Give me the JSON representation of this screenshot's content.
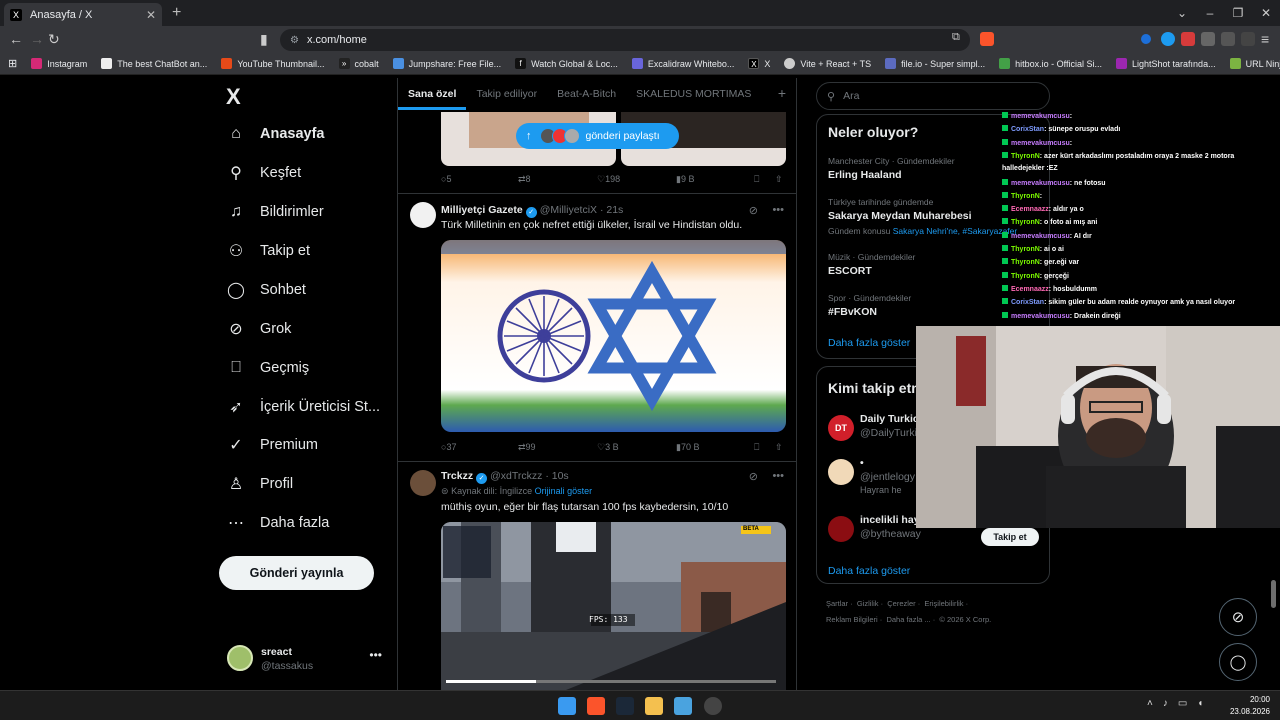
{
  "browser": {
    "tab_title": "Anasayfa / X",
    "tab_favicon": "X",
    "url": "x.com/home",
    "bookmarks": [
      "Instagram",
      "The best ChatBot an...",
      "YouTube Thumbnail...",
      "cobalt",
      "Jumpshare: Free File...",
      "Watch Global & Loc...",
      "Excalidraw Whitebo...",
      "X",
      "Vite + React + TS",
      "file.io - Super simpl...",
      "hitbox.io - Official Si...",
      "LightShot tarafında...",
      "URL Ninja (1)"
    ]
  },
  "nav": {
    "logo": "X",
    "items": [
      {
        "label": "Anasayfa",
        "icon": "home-icon"
      },
      {
        "label": "Keşfet",
        "icon": "search-icon"
      },
      {
        "label": "Bildirimler",
        "icon": "bell-icon"
      },
      {
        "label": "Takip et",
        "icon": "add-user-icon"
      },
      {
        "label": "Sohbet",
        "icon": "chat-icon"
      },
      {
        "label": "Grok",
        "icon": "grok-icon"
      },
      {
        "label": "Geçmiş",
        "icon": "bookmark-icon"
      },
      {
        "label": "İçerik Üreticisi St...",
        "icon": "rocket-icon"
      },
      {
        "label": "Premium",
        "icon": "verified-icon"
      },
      {
        "label": "Profil",
        "icon": "profile-icon"
      },
      {
        "label": "Daha fazla",
        "icon": "more-icon"
      }
    ],
    "post_button": "Gönderi yayınla",
    "account": {
      "name": "sreact",
      "handle": "@tassakus"
    }
  },
  "timeline": {
    "tabs": [
      "Sana özel",
      "Takip ediliyor",
      "Beat-A-Bitch",
      "SKALEDUS MORTIMAS"
    ],
    "share_pill": "gönderi paylaştı",
    "prev_post_actions": {
      "replies": "5",
      "reposts": "8",
      "likes": "198",
      "views": "9 B"
    },
    "posts": [
      {
        "name": "Milliyetçi Gazete",
        "handle": "@MilliyetciX",
        "time": "· 21s",
        "text": "Türk Milletinin en çok nefret ettiği ülkeler, İsrail ve Hindistan oldu.",
        "actions": {
          "replies": "37",
          "reposts": "99",
          "likes": "3 B",
          "views": "70 B"
        }
      },
      {
        "name": "Trckzz",
        "handle": "@xdTrckzz",
        "time": "· 10s",
        "lang_note": "Kaynak dili: İngilizce",
        "lang_link": "Orijinali göster",
        "text": "müthiş oyun, eğer bir flaş tutarsan 100 fps kaybedersin, 10/10",
        "fps_overlay": "FPS: 133",
        "beta_tag": "BETA"
      }
    ]
  },
  "right": {
    "search_placeholder": "Ara",
    "trends_title": "Neler oluyor?",
    "trends": [
      {
        "context": "Manchester City · Gündemdekiler",
        "title": "Erling Haaland"
      },
      {
        "context": "Türkiye tarihinde gündemde",
        "title": "Sakarya Meydan Muharebesi",
        "topic_prefix": "Gündem konusu",
        "topic_links": "Sakarya Nehri'ne, #Sakaryazafer"
      },
      {
        "context": "Müzik · Gündemdekiler",
        "title": "ESCORT"
      },
      {
        "context": "Spor · Gündemdekiler",
        "title": "#FBvKON"
      }
    ],
    "show_more": "Daha fazla göster",
    "who_title": "Kimi takip etm",
    "who": [
      {
        "name": "Daily Turkic",
        "handle": "@DailyTurkic",
        "initials": "DT"
      },
      {
        "name": "•",
        "handle": "@jentlelogy",
        "extra": "Hayran he"
      },
      {
        "name": "incelikli hay",
        "handle": "@bytheaway"
      }
    ],
    "follow_button": "Takip et",
    "who_show_more": "Daha fazla göster",
    "footer_line1": [
      "Şartlar",
      "Gizlilik",
      "Çerezler",
      "Erişilebilirlik"
    ],
    "footer_line2": [
      "Reklam Bilgileri",
      "Daha fazla ...",
      "© 2026 X Corp."
    ]
  },
  "chat": [
    {
      "user": "memevakumcusu",
      "msg": ": ",
      "color": "#c77dff"
    },
    {
      "user": "CorixStan",
      "msg": ": sünepe oruspu evladı",
      "color": "#7f9cff"
    },
    {
      "user": "memevakumcusu",
      "msg": ": ",
      "color": "#c77dff"
    },
    {
      "user": "ThyronN",
      "msg": ": azer kürt arkadaslımı postaladım oraya 2 maske 2 motora",
      "color": "#7cfc00"
    },
    {
      "user": "",
      "msg": "halledejekler :EZ",
      "color": "#ffffff"
    },
    {
      "user": "memevakumcusu",
      "msg": ": ne fotosu",
      "color": "#c77dff"
    },
    {
      "user": "ThyronN",
      "msg": ": ",
      "color": "#7cfc00"
    },
    {
      "user": "Ecemnaazz",
      "msg": ": aldır ya o",
      "color": "#ff69b4"
    },
    {
      "user": "ThyronN",
      "msg": ": o foto ai mış ani",
      "color": "#7cfc00"
    },
    {
      "user": "memevakumcusu",
      "msg": ": AI dır",
      "color": "#c77dff"
    },
    {
      "user": "ThyronN",
      "msg": ": ai o ai",
      "color": "#7cfc00"
    },
    {
      "user": "ThyronN",
      "msg": ": ger.eği var",
      "color": "#7cfc00"
    },
    {
      "user": "ThyronN",
      "msg": ": gerçeği",
      "color": "#7cfc00"
    },
    {
      "user": "Ecemnaazz",
      "msg": ": hosbuldumm",
      "color": "#ff69b4"
    },
    {
      "user": "CorixStan",
      "msg": ": sikim güler bu adam realde oynuyor amk ya nasıl oluyor",
      "color": "#7f9cff"
    },
    {
      "user": "memevakumcusu",
      "msg": ": Drakein direği",
      "color": "#c77dff"
    }
  ],
  "taskbar": {
    "time": "20:00",
    "date": "23.08.2026"
  },
  "colors": {
    "accent": "#1d9bf0",
    "background": "#000000",
    "border": "#2f3336",
    "muted": "#71767b"
  }
}
